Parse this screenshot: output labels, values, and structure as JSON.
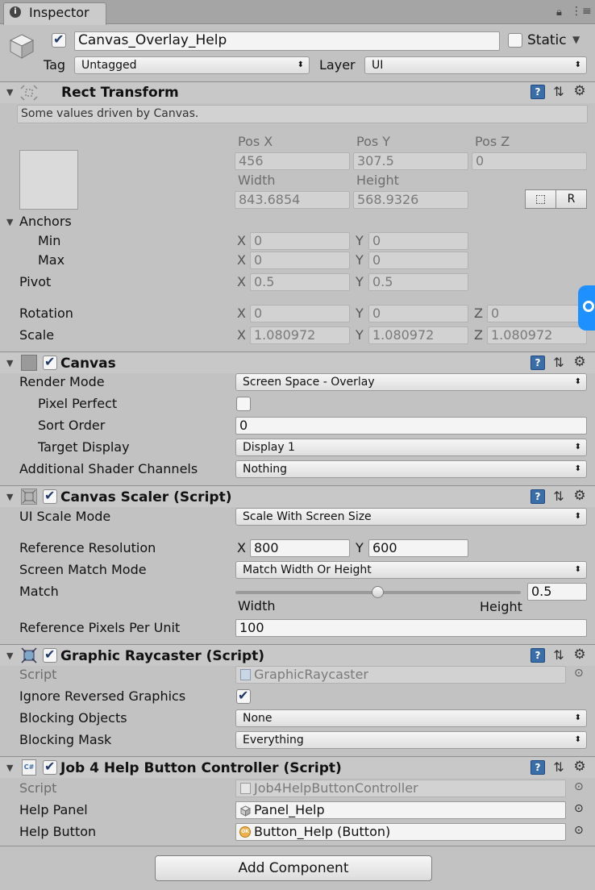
{
  "tab": {
    "title": "Inspector"
  },
  "object": {
    "name": "Canvas_Overlay_Help",
    "static_label": "Static",
    "tag_label": "Tag",
    "tag_value": "Untagged",
    "layer_label": "Layer",
    "layer_value": "UI"
  },
  "rect_transform": {
    "title": "Rect Transform",
    "note": "Some values driven by Canvas.",
    "pos_x_label": "Pos X",
    "pos_y_label": "Pos Y",
    "pos_z_label": "Pos Z",
    "pos_x": "456",
    "pos_y": "307.5",
    "pos_z": "0",
    "width_label": "Width",
    "height_label": "Height",
    "width": "843.6854",
    "height": "568.9326",
    "r_button": "R",
    "anchors_label": "Anchors",
    "min_label": "Min",
    "max_label": "Max",
    "min_x": "0",
    "min_y": "0",
    "max_x": "0",
    "max_y": "0",
    "pivot_label": "Pivot",
    "pivot_x": "0.5",
    "pivot_y": "0.5",
    "rotation_label": "Rotation",
    "rot_x": "0",
    "rot_y": "0",
    "rot_z": "0",
    "scale_label": "Scale",
    "scale_x": "1.080972",
    "scale_y": "1.080972",
    "scale_z": "1.080972",
    "x": "X",
    "y": "Y",
    "z": "Z"
  },
  "canvas": {
    "title": "Canvas",
    "render_mode_label": "Render Mode",
    "render_mode": "Screen Space - Overlay",
    "pixel_perfect_label": "Pixel Perfect",
    "sort_order_label": "Sort Order",
    "sort_order": "0",
    "target_display_label": "Target Display",
    "target_display": "Display 1",
    "shader_channels_label": "Additional Shader Channels",
    "shader_channels": "Nothing"
  },
  "canvas_scaler": {
    "title": "Canvas Scaler (Script)",
    "scale_mode_label": "UI Scale Mode",
    "scale_mode": "Scale With Screen Size",
    "ref_res_label": "Reference Resolution",
    "ref_x": "800",
    "ref_y": "600",
    "match_mode_label": "Screen Match Mode",
    "match_mode": "Match Width Or Height",
    "match_label": "Match",
    "match_value": "0.5",
    "width_label": "Width",
    "height_label": "Height",
    "ppu_label": "Reference Pixels Per Unit",
    "ppu": "100"
  },
  "raycaster": {
    "title": "Graphic Raycaster (Script)",
    "script_label": "Script",
    "script": "GraphicRaycaster",
    "ignore_label": "Ignore Reversed Graphics",
    "blocking_objects_label": "Blocking Objects",
    "blocking_objects": "None",
    "blocking_mask_label": "Blocking Mask",
    "blocking_mask": "Everything"
  },
  "job4": {
    "title": "Job 4 Help Button Controller (Script)",
    "script_label": "Script",
    "script": "Job4HelpButtonController",
    "help_panel_label": "Help Panel",
    "help_panel": "Panel_Help",
    "help_button_label": "Help Button",
    "help_button": "Button_Help (Button)"
  },
  "add_component": "Add Component",
  "colors": {
    "background": "#c2c2c2",
    "header": "#c8c8c8",
    "accent": "#3b6ea8",
    "edge_button": "#1e90ff"
  }
}
